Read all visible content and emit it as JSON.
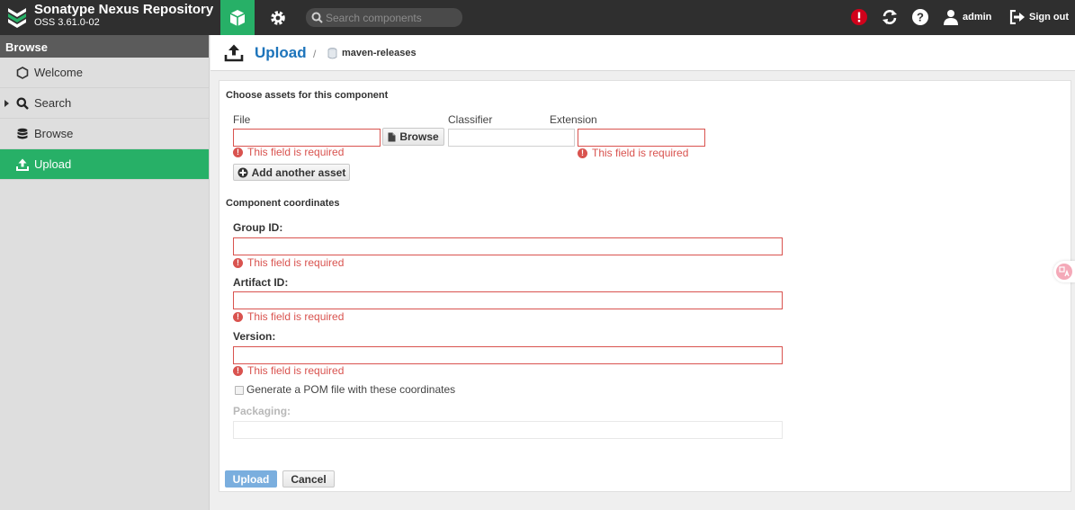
{
  "app": {
    "title": "Sonatype Nexus Repository",
    "version": "OSS 3.61.0-02"
  },
  "header": {
    "search_placeholder": "Search components",
    "user": "admin",
    "signout_label": "Sign out",
    "icons": [
      "browse-mode-cube-icon",
      "admin-gear-icon",
      "search-icon",
      "system-alert-icon",
      "refresh-icon",
      "help-icon",
      "user-icon",
      "sign-out-icon"
    ]
  },
  "sidebar": {
    "title": "Browse",
    "items": [
      {
        "label": "Welcome",
        "icon": "hexagon-icon",
        "active": false
      },
      {
        "label": "Search",
        "icon": "search-icon",
        "active": false,
        "collapsed": true
      },
      {
        "label": "Browse",
        "icon": "database-icon",
        "active": false
      },
      {
        "label": "Upload",
        "icon": "upload-icon",
        "active": true
      }
    ]
  },
  "page": {
    "title": "Upload",
    "breadcrumb_separator": "/",
    "repository": "maven-releases"
  },
  "form": {
    "assets_section_title": "Choose assets for this component",
    "file_label": "File",
    "classifier_label": "Classifier",
    "extension_label": "Extension",
    "browse_button": "Browse",
    "add_asset_button": "Add another asset",
    "coordinates_section_title": "Component coordinates",
    "group_id_label": "Group ID:",
    "artifact_id_label": "Artifact ID:",
    "version_label": "Version:",
    "generate_pom_label": "Generate a POM file with these coordinates",
    "generate_pom_checked": false,
    "packaging_label": "Packaging:",
    "required_error": "This field is required",
    "error_icon": "!",
    "upload_button": "Upload",
    "cancel_button": "Cancel"
  },
  "colors": {
    "header_bg": "#2f2f2f",
    "accent_green": "#27b067",
    "link_blue": "#1d74bb",
    "error_red": "#d9534f",
    "primary_button": "#7aaede"
  }
}
